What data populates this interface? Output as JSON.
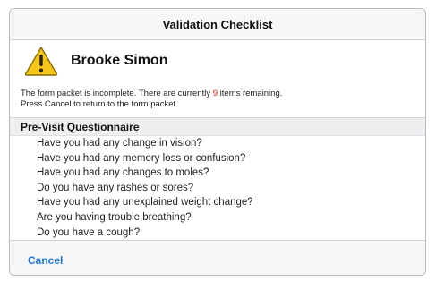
{
  "dialog": {
    "title": "Validation Checklist",
    "person_name": "Brooke Simon",
    "icon": "warning-triangle-icon",
    "message": {
      "before_count": "The form packet is incomplete. There are currently ",
      "count": "9",
      "after_count": " items remaining.",
      "line2": "Press Cancel to return to the form packet."
    },
    "colors": {
      "count": "#e02020",
      "accent": "#1f7ae0",
      "warning_fill": "#f5c518"
    },
    "section": {
      "title": "Pre-Visit Questionnaire",
      "items": [
        "Have you had any change in vision?",
        "Have you had any memory loss or confusion?",
        "Have you had any changes to moles?",
        "Do you have any rashes or sores?",
        "Have you had any unexplained weight change?",
        "Are you having trouble breathing?",
        "Do you have a cough?"
      ]
    },
    "cancel_label": "Cancel"
  }
}
